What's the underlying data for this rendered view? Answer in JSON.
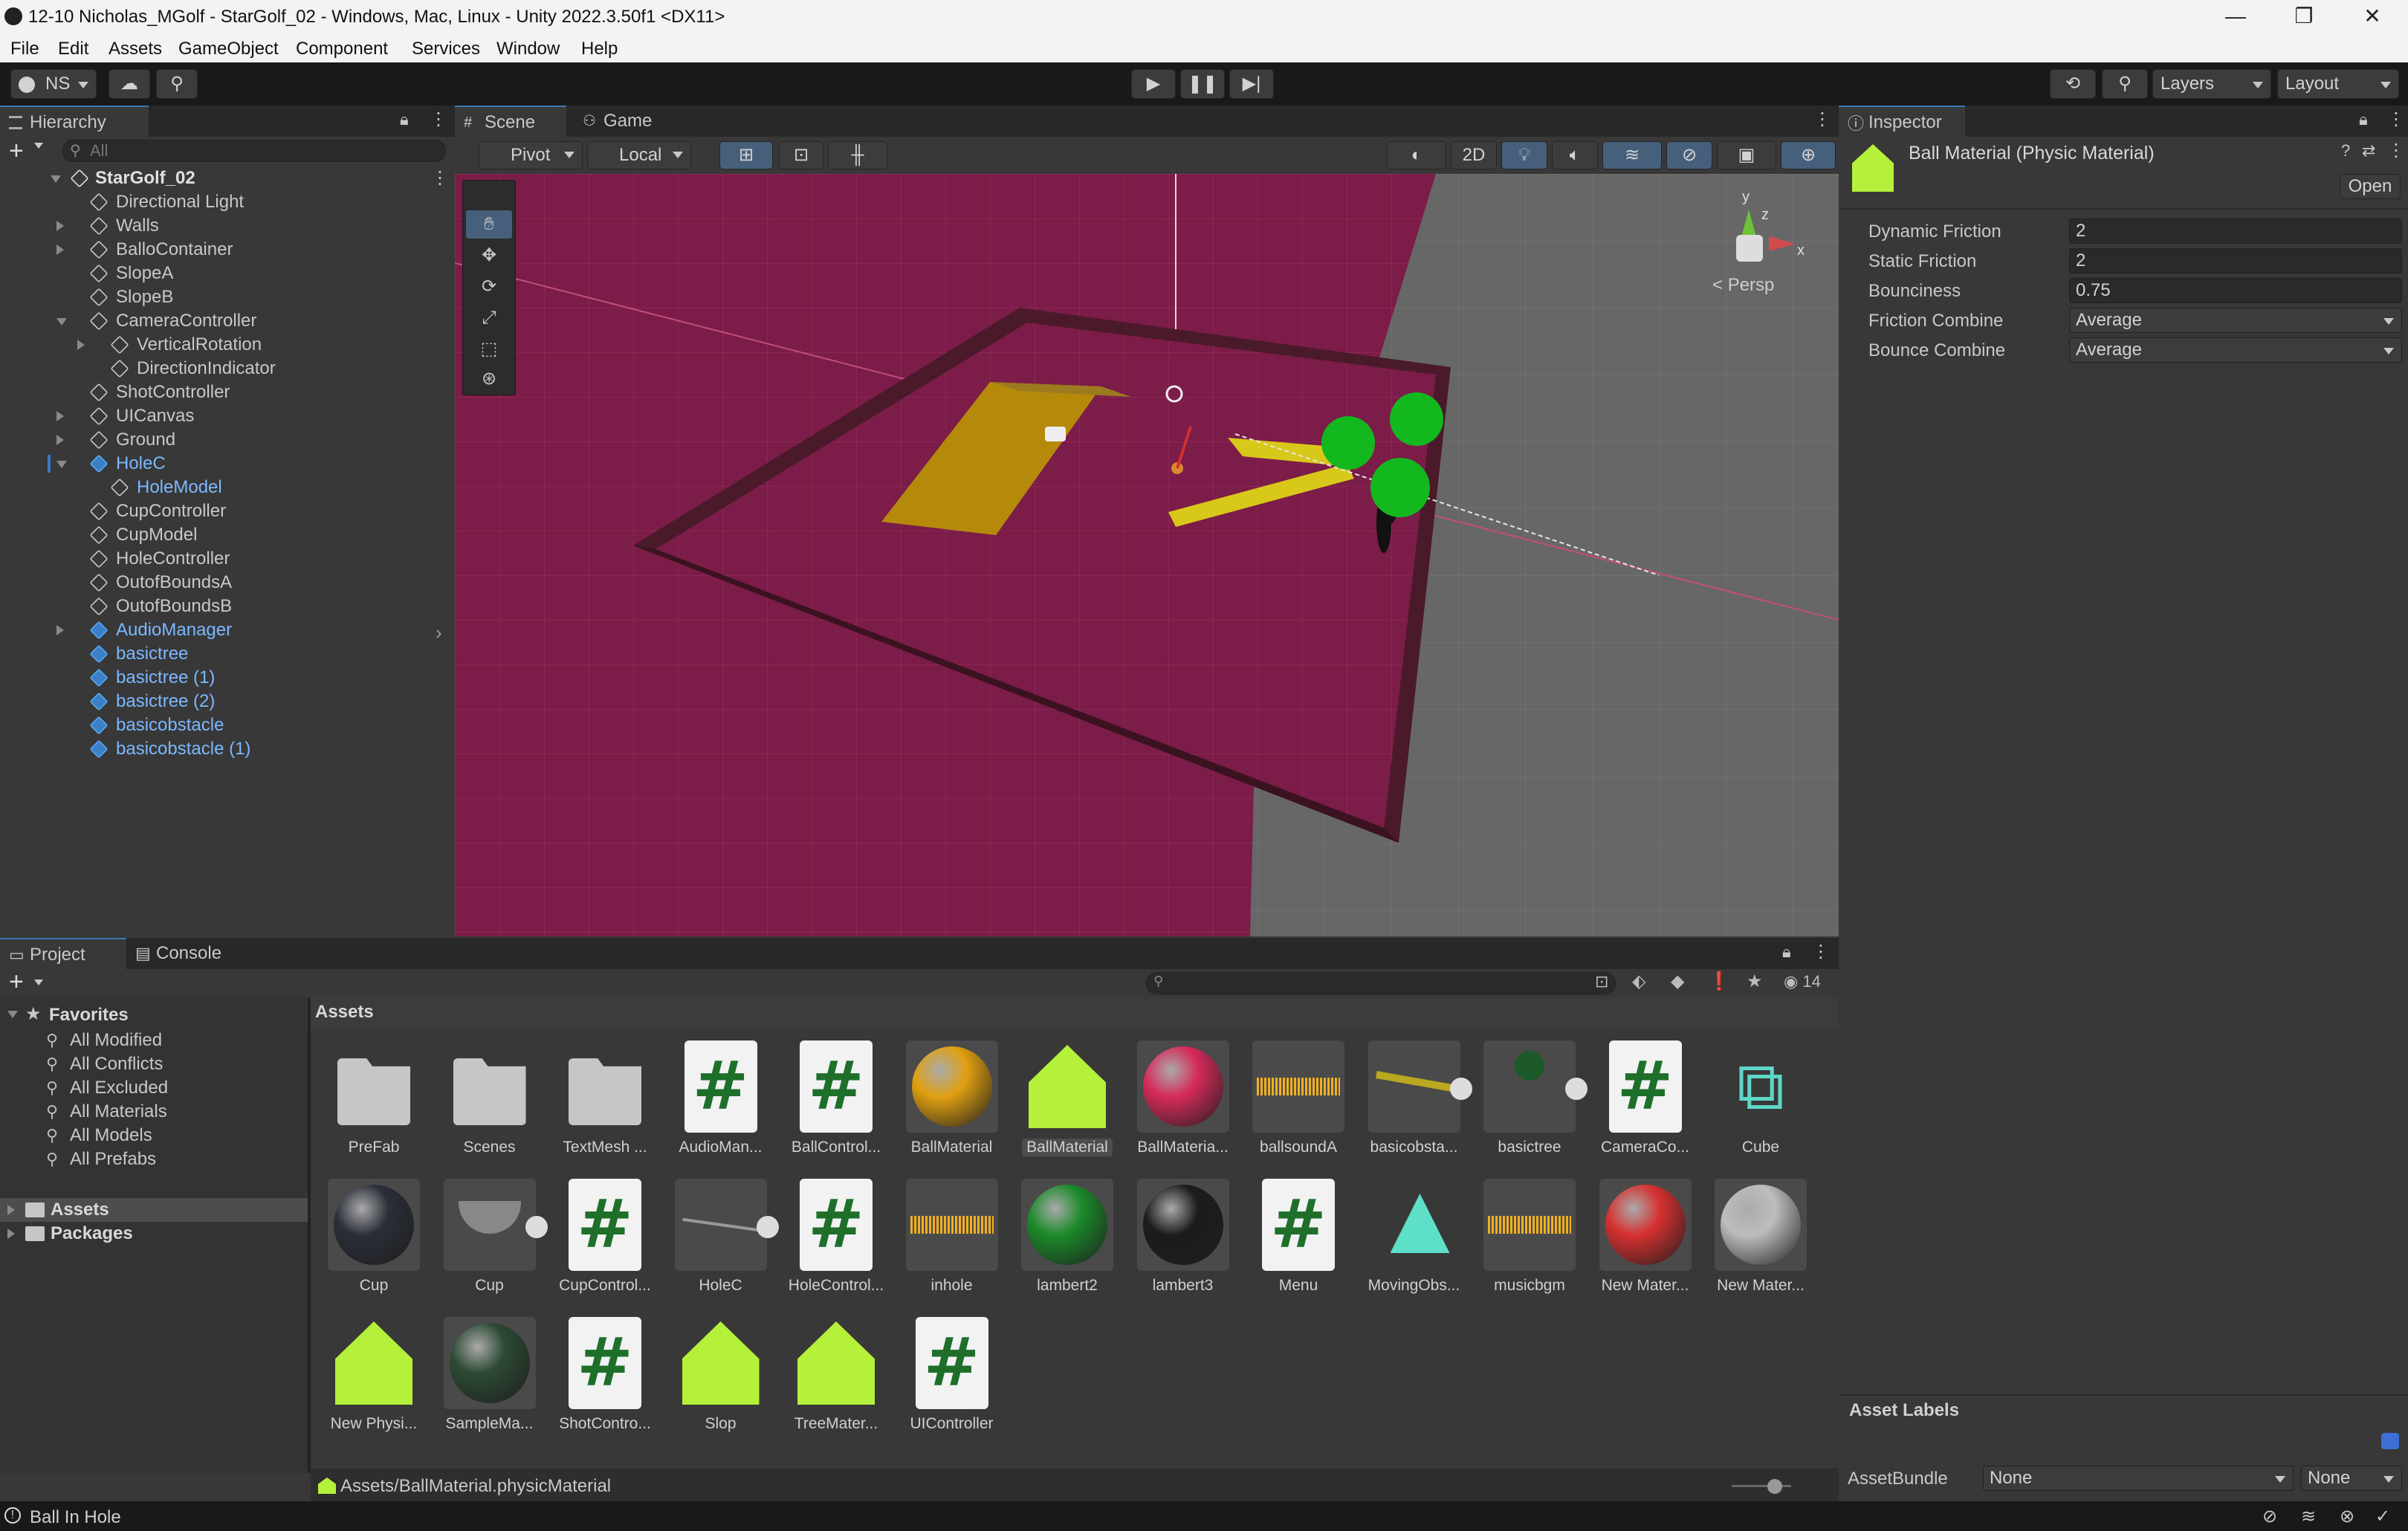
{
  "window": {
    "title": "12-10 Nicholas_MGolf - StarGolf_02 - Windows, Mac, Linux - Unity 2022.3.50f1 <DX11>",
    "minimize": "—",
    "maximize": "❐",
    "close": "✕"
  },
  "menu": [
    "File",
    "Edit",
    "Assets",
    "GameObject",
    "Component",
    "Services",
    "Window",
    "Help"
  ],
  "toolbar": {
    "account": "NS",
    "layers": "Layers",
    "layout": "Layout"
  },
  "hierarchy": {
    "tab": "Hierarchy",
    "search_placeholder": "All",
    "scene": "StarGolf_02",
    "items": [
      {
        "label": "Directional Light",
        "depth": 1,
        "arrow": "",
        "prefab": false
      },
      {
        "label": "Walls",
        "depth": 1,
        "arrow": "right",
        "prefab": false
      },
      {
        "label": "BalloContainer",
        "depth": 1,
        "arrow": "right",
        "prefab": false
      },
      {
        "label": "SlopeA",
        "depth": 1,
        "arrow": "",
        "prefab": false
      },
      {
        "label": "SlopeB",
        "depth": 1,
        "arrow": "",
        "prefab": false
      },
      {
        "label": "CameraController",
        "depth": 1,
        "arrow": "down",
        "prefab": false
      },
      {
        "label": "VerticalRotation",
        "depth": 2,
        "arrow": "right",
        "prefab": false
      },
      {
        "label": "DirectionIndicator",
        "depth": 2,
        "arrow": "",
        "prefab": false
      },
      {
        "label": "ShotController",
        "depth": 1,
        "arrow": "",
        "prefab": false
      },
      {
        "label": "UICanvas",
        "depth": 1,
        "arrow": "right",
        "prefab": false
      },
      {
        "label": "Ground",
        "depth": 1,
        "arrow": "right",
        "prefab": false
      },
      {
        "label": "HoleC",
        "depth": 1,
        "arrow": "down",
        "prefab": true
      },
      {
        "label": "HoleModel",
        "depth": 2,
        "arrow": "",
        "prefab": "child"
      },
      {
        "label": "CupController",
        "depth": 1,
        "arrow": "",
        "prefab": false
      },
      {
        "label": "CupModel",
        "depth": 1,
        "arrow": "",
        "prefab": false
      },
      {
        "label": "HoleController",
        "depth": 1,
        "arrow": "",
        "prefab": false
      },
      {
        "label": "OutofBoundsA",
        "depth": 1,
        "arrow": "",
        "prefab": false
      },
      {
        "label": "OutofBoundsB",
        "depth": 1,
        "arrow": "",
        "prefab": false
      },
      {
        "label": "AudioManager",
        "depth": 1,
        "arrow": "right",
        "prefab": true
      },
      {
        "label": "basictree",
        "depth": 1,
        "arrow": "",
        "prefab": true
      },
      {
        "label": "basictree (1)",
        "depth": 1,
        "arrow": "",
        "prefab": true
      },
      {
        "label": "basictree (2)",
        "depth": 1,
        "arrow": "",
        "prefab": true
      },
      {
        "label": "basicobstacle",
        "depth": 1,
        "arrow": "",
        "prefab": true
      },
      {
        "label": "basicobstacle (1)",
        "depth": 1,
        "arrow": "",
        "prefab": true
      }
    ]
  },
  "scene_view": {
    "tabs": [
      "Scene",
      "Game"
    ],
    "pivot": "Pivot",
    "local": "Local",
    "mode_2d": "2D",
    "persp": "Persp",
    "axis_x": "x",
    "axis_y": "y",
    "axis_z": "z"
  },
  "inspector": {
    "tab": "Inspector",
    "title": "Ball Material (Physic Material)",
    "open_button": "Open",
    "fields": [
      {
        "label": "Dynamic Friction",
        "value": "2",
        "dropdown": false
      },
      {
        "label": "Static Friction",
        "value": "2",
        "dropdown": false
      },
      {
        "label": "Bounciness",
        "value": "0.75",
        "dropdown": false
      },
      {
        "label": "Friction Combine",
        "value": "Average",
        "dropdown": true
      },
      {
        "label": "Bounce Combine",
        "value": "Average",
        "dropdown": true
      }
    ],
    "asset_labels": "Asset Labels",
    "assetbundle_label": "AssetBundle",
    "assetbundle_value": "None",
    "assetbundle_variant": "None"
  },
  "project": {
    "tabs": [
      "Project",
      "Console"
    ],
    "hidden_count": "14",
    "favorites_title": "Favorites",
    "favorites": [
      "All Modified",
      "All Conflicts",
      "All Excluded",
      "All Materials",
      "All Models",
      "All Prefabs"
    ],
    "roots": [
      "Assets",
      "Packages"
    ],
    "breadcrumb": "Assets",
    "path": "Assets/BallMaterial.physicMaterial",
    "assets": [
      {
        "label": "PreFab",
        "kind": "folder"
      },
      {
        "label": "Scenes",
        "kind": "folder"
      },
      {
        "label": "TextMesh ...",
        "kind": "folder"
      },
      {
        "label": "AudioMan...",
        "kind": "script"
      },
      {
        "label": "BallControl...",
        "kind": "script"
      },
      {
        "label": "BallMaterial",
        "kind": "material",
        "color": "#e0a010"
      },
      {
        "label": "BallMaterial",
        "kind": "physic",
        "selected": true
      },
      {
        "label": "BallMateria...",
        "kind": "material",
        "color": "#d62a5a"
      },
      {
        "label": "ballsoundA",
        "kind": "audio"
      },
      {
        "label": "basicobsta...",
        "kind": "prefab-obstacle"
      },
      {
        "label": "basictree",
        "kind": "prefab-tree"
      },
      {
        "label": "CameraCo...",
        "kind": "script"
      },
      {
        "label": "Cube",
        "kind": "cube"
      },
      {
        "label": "Cup",
        "kind": "material",
        "color": "#2a2e38"
      },
      {
        "label": "Cup",
        "kind": "prefab-cup"
      },
      {
        "label": "CupControl...",
        "kind": "script"
      },
      {
        "label": "HoleC",
        "kind": "prefab-hole"
      },
      {
        "label": "HoleControl...",
        "kind": "script"
      },
      {
        "label": "inhole",
        "kind": "audio"
      },
      {
        "label": "lambert2",
        "kind": "material",
        "color": "#1b8a2a"
      },
      {
        "label": "lambert3",
        "kind": "material",
        "color": "#1c1c1c"
      },
      {
        "label": "Menu",
        "kind": "script"
      },
      {
        "label": "MovingObs...",
        "kind": "anim"
      },
      {
        "label": "musicbgm",
        "kind": "audio"
      },
      {
        "label": "New Mater...",
        "kind": "material",
        "color": "#d63030"
      },
      {
        "label": "New Mater...",
        "kind": "material",
        "color": "#bdbdbd"
      },
      {
        "label": "New Physi...",
        "kind": "physic"
      },
      {
        "label": "SampleMa...",
        "kind": "material",
        "color": "#2d4a34"
      },
      {
        "label": "ShotContro...",
        "kind": "script"
      },
      {
        "label": "Slop",
        "kind": "physic"
      },
      {
        "label": "TreeMater...",
        "kind": "physic"
      },
      {
        "label": "UIController",
        "kind": "script"
      }
    ]
  },
  "status": {
    "message": "Ball In Hole"
  },
  "colors": {
    "accent": "#3a79bb",
    "prefab": "#7cb8ff",
    "physic": "#b5f03a"
  }
}
